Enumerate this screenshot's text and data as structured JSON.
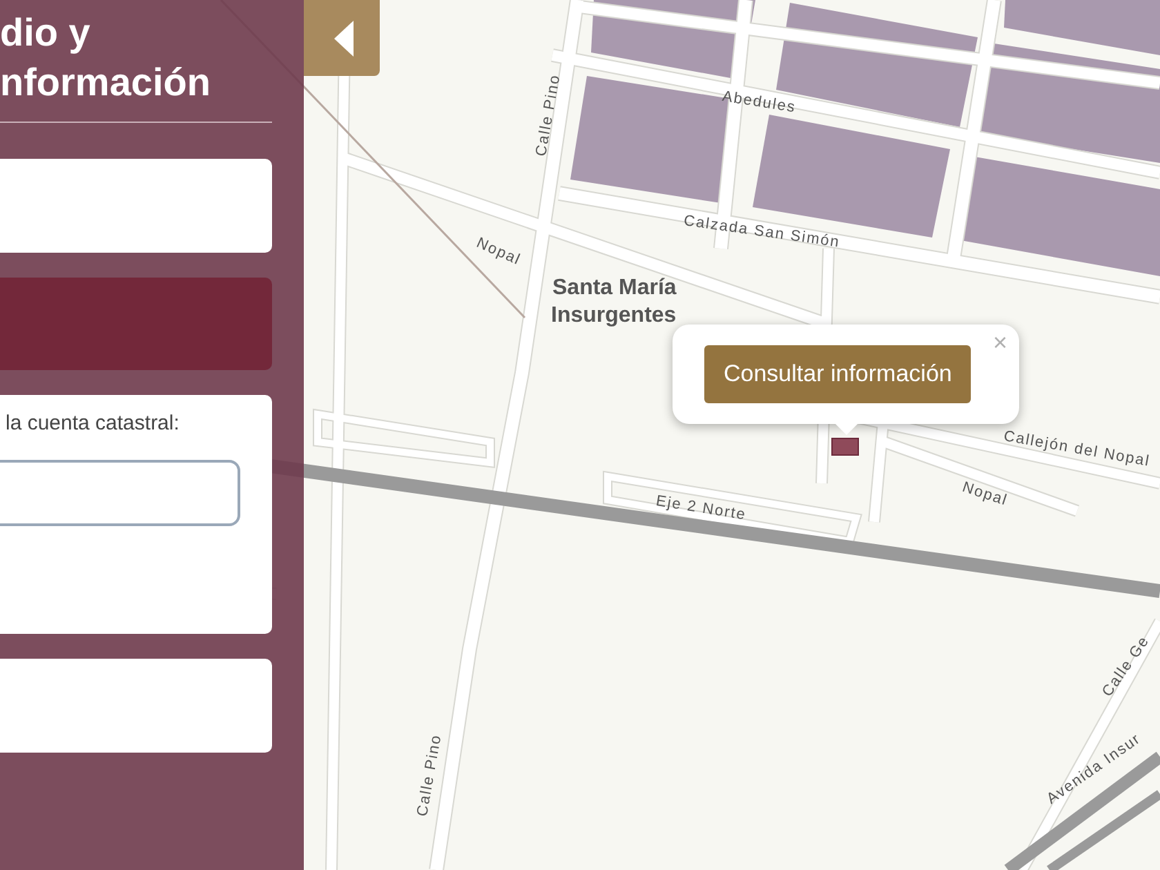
{
  "panel": {
    "title_lines": [
      "dio y",
      "nformación"
    ],
    "cards": [
      {
        "kind": "plain"
      },
      {
        "kind": "accent"
      },
      {
        "kind": "form",
        "label": "la cuenta catastral:"
      },
      {
        "kind": "plain"
      }
    ]
  },
  "map": {
    "labels": [
      {
        "kind": "district",
        "text": "Santa María"
      },
      {
        "kind": "district",
        "text": "Insurgentes"
      },
      {
        "kind": "street",
        "text": "Abedules"
      },
      {
        "kind": "street",
        "text": "Calzada San Simón"
      },
      {
        "kind": "street",
        "text": "Nopal"
      },
      {
        "kind": "street",
        "text": "Calle Pino"
      },
      {
        "kind": "street",
        "text": "Eje 2 Norte"
      },
      {
        "kind": "street",
        "text": "Callejón del Nopal"
      },
      {
        "kind": "street",
        "text": "Nopal"
      },
      {
        "kind": "street",
        "text": "Calle Pino"
      },
      {
        "kind": "street",
        "text": "Calle Ge"
      },
      {
        "kind": "street",
        "text": "Avenida Insur"
      }
    ]
  },
  "popup": {
    "button": "Consultar información",
    "close": "×"
  }
}
